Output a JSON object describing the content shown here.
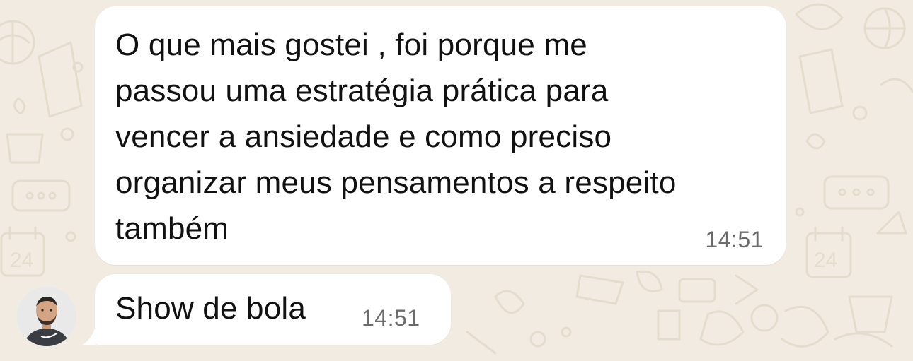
{
  "chat": {
    "background_color": "#f1ebe2",
    "messages": [
      {
        "text": "O que mais gostei , foi porque me\npassou uma estratégia prática para\nvencer a ansiedade e como preciso\norganizar meus pensamentos a respeito\ntambém",
        "time": "14:51",
        "direction": "incoming"
      },
      {
        "text": "Show de bola",
        "time": "14:51",
        "direction": "incoming"
      }
    ],
    "sender": {
      "avatar_icon": "person-avatar"
    }
  }
}
